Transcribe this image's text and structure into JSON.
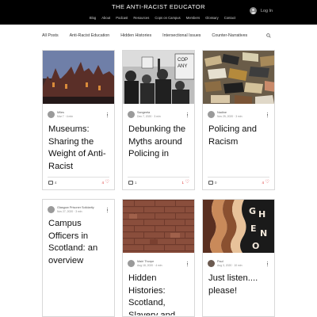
{
  "header": {
    "site_title": "THE ANTI-RACIST EDUCATOR",
    "nav": [
      "Blog",
      "About",
      "Podcast",
      "Resources",
      "Cops on Campus",
      "Members",
      "Glossary",
      "Contact"
    ],
    "login_label": "Log In"
  },
  "categories": [
    "All Posts",
    "Anti-Racist Education",
    "Hidden Histories",
    "Intersectional Issues",
    "Counter-Narratives"
  ],
  "posts": [
    {
      "author": "Miles",
      "date": "Mar 7",
      "read": "4 min",
      "title": "Museums: Sharing the Weight of Anti-Racist",
      "comments": "4",
      "likes": "4"
    },
    {
      "author": "Sangeeta",
      "date": "Dec 7, 2020",
      "read": "3 min",
      "title": "Debunking the Myths around Policing in",
      "comments": "1",
      "likes": "1"
    },
    {
      "author": "Nadine",
      "date": "Nov 25, 2020",
      "read": "3 min",
      "title": "Policing and Racism",
      "comments": "0",
      "likes": "4"
    },
    {
      "author": "Glasgow Prisoner Solidarity",
      "date": "Nov 27, 2020",
      "read": "3 min",
      "title": "Campus Officers in Scotland: an overview"
    },
    {
      "author": "Mairi Thorpe",
      "date": "Aug 18, 2020",
      "read": "4 min",
      "title": "Hidden Histories: Scotland, Slavery and"
    },
    {
      "author": "Paul",
      "date": "Aug 3, 2020",
      "read": "10 min",
      "title": "Just listen.... please!"
    }
  ],
  "icons": {
    "search": "search-icon",
    "login": "user-icon",
    "more": "more-options-icon",
    "comment": "comment-icon",
    "like": "heart-icon"
  },
  "colors": {
    "header_bg": "#000000",
    "like_red": "#dd3333"
  }
}
